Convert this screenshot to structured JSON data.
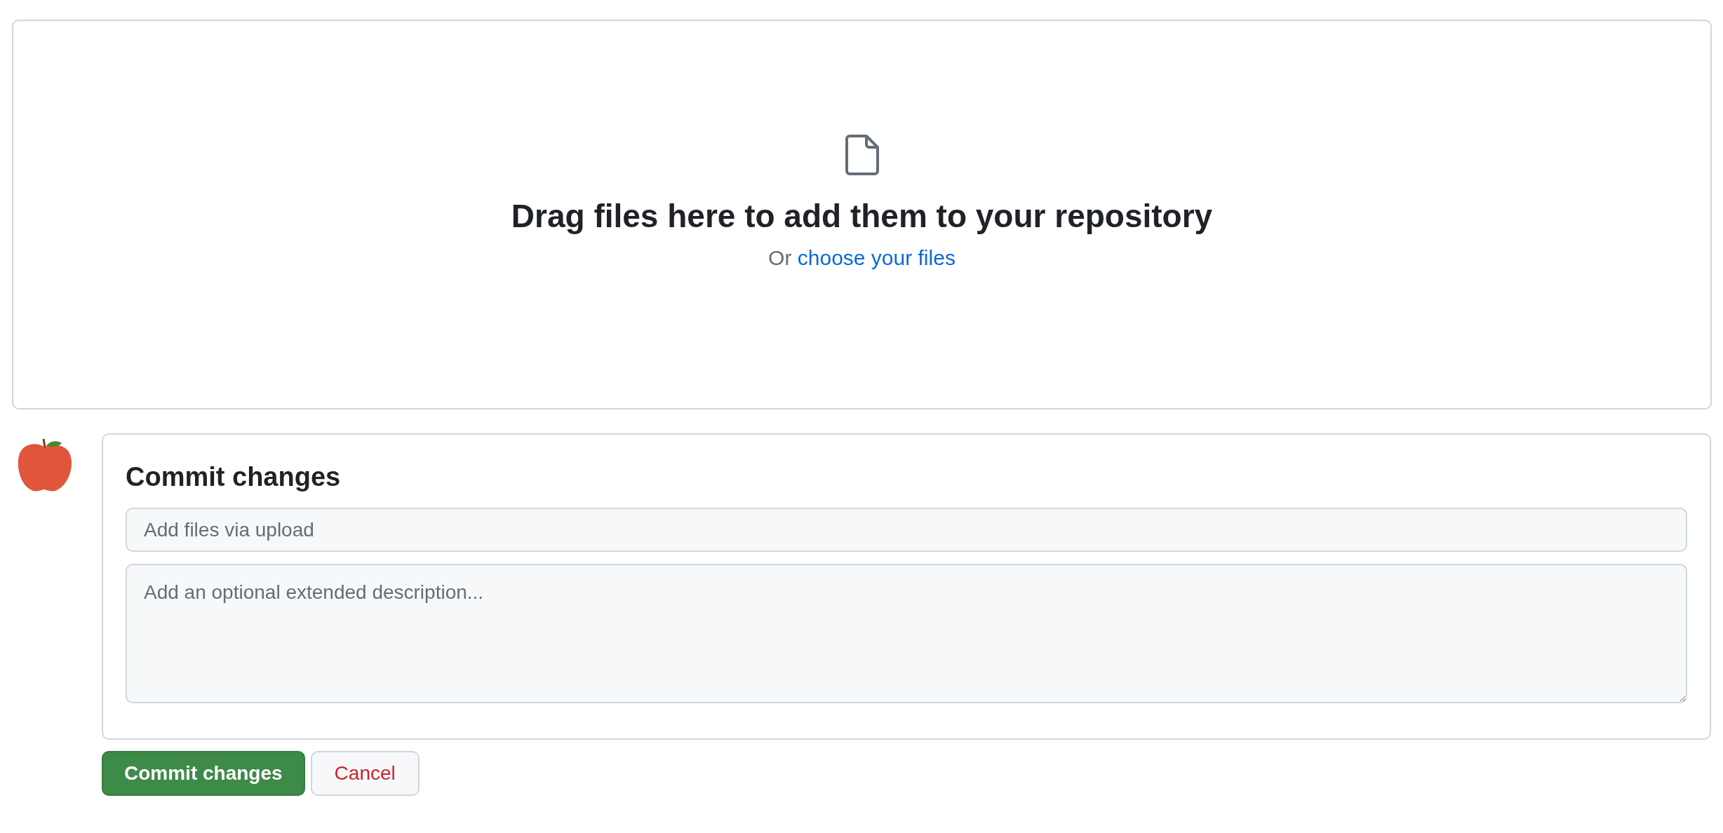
{
  "upload": {
    "heading": "Drag files here to add them to your repository",
    "prompt_prefix": "Or",
    "link": "choose your files"
  },
  "commit": {
    "title": "Commit changes",
    "summary": {
      "placeholder": "Add files via upload"
    },
    "description": {
      "placeholder": "Add an optional extended description..."
    }
  },
  "buttons": [
    {
      "label": "Commit changes",
      "kind": "primary"
    },
    {
      "label": "Cancel",
      "kind": "danger"
    }
  ]
}
